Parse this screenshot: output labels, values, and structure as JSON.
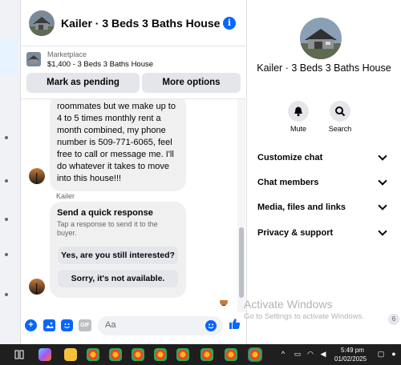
{
  "chat": {
    "title": "Kailer · 3 Beds 3 Baths House",
    "marketplace": {
      "category": "Marketplace",
      "listing": "$1,400 - 3 Beds 3 Baths House",
      "pending_label": "Mark as pending",
      "more_label": "More options"
    },
    "message_text": "roommates but we make up to 4 to 5 times monthly rent a month combined, my phone number is 509-771-6065, feel free to call or message me. I'll do whatever it takes to move into this house!!!",
    "sender_name": "Kailer",
    "quick_response": {
      "title": "Send a quick response",
      "description": "Tap a response to send it to the buyer.",
      "option_1": "Yes, are you still interested?",
      "option_2": "Sorry, it's not available."
    },
    "composer_placeholder": "Aa",
    "gif_label": "GIF"
  },
  "details": {
    "title": "Kailer · 3 Beds 3 Baths House",
    "actions": [
      {
        "label": "Mute",
        "icon": "bell-icon"
      },
      {
        "label": "Search",
        "icon": "search-icon"
      }
    ],
    "menu": [
      {
        "label": "Customize chat"
      },
      {
        "label": "Chat members"
      },
      {
        "label": "Media, files and links"
      },
      {
        "label": "Privacy & support"
      }
    ]
  },
  "watermark": {
    "line1": "Activate Windows",
    "line2": "Go to Settings to activate Windows."
  },
  "notification_count": "6",
  "taskbar": {
    "time": "5:49 pm",
    "date": "01/02/2025"
  },
  "colors": {
    "accent": "#0866ff",
    "bubble": "#f0f0f0",
    "button": "#e4e6eb",
    "taskbar": "#1f1f1f"
  }
}
